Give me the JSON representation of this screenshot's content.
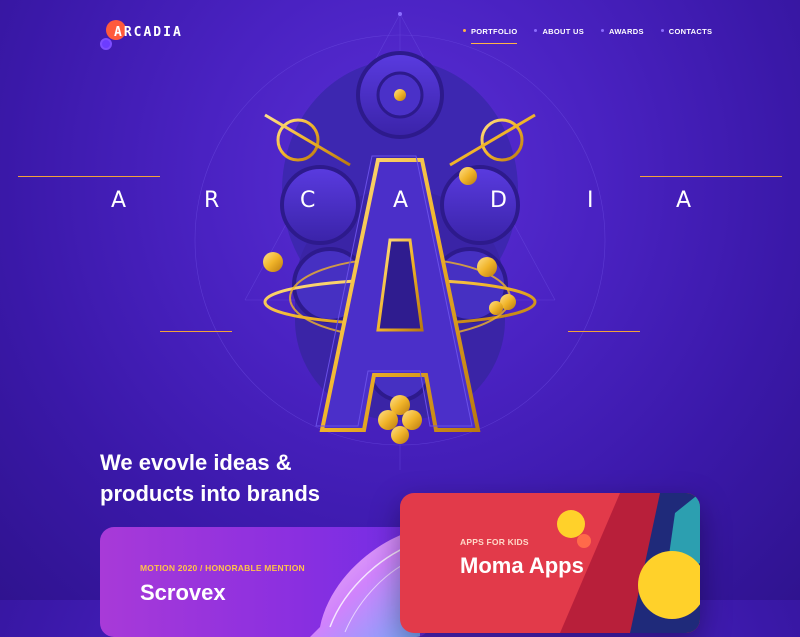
{
  "brand": {
    "logo_text": "ARCADIA"
  },
  "nav": [
    {
      "label": "PORTFOLIO",
      "active": true
    },
    {
      "label": "ABOUT US",
      "active": false
    },
    {
      "label": "AWARDS",
      "active": false
    },
    {
      "label": "CONTACTS",
      "active": false
    }
  ],
  "hero": {
    "letters": [
      "A",
      "R",
      "C",
      "A",
      "D",
      "I",
      "A"
    ]
  },
  "tagline": {
    "line1": "We evovle ideas &",
    "line2": "products into brands"
  },
  "cards": [
    {
      "tag": "MOTION 2020 / HONORABLE MENTION",
      "title": "Scrovex"
    },
    {
      "tag": "APPS FOR KIDS",
      "title": "Moma Apps"
    }
  ],
  "colors": {
    "background": "#3a18a8",
    "accent_orange": "#f2a23a",
    "emblem_purple": "#4b2fc9",
    "gold": "#f0b429",
    "card_red": "#e23a4a",
    "card_purple": "#a83ad8"
  }
}
